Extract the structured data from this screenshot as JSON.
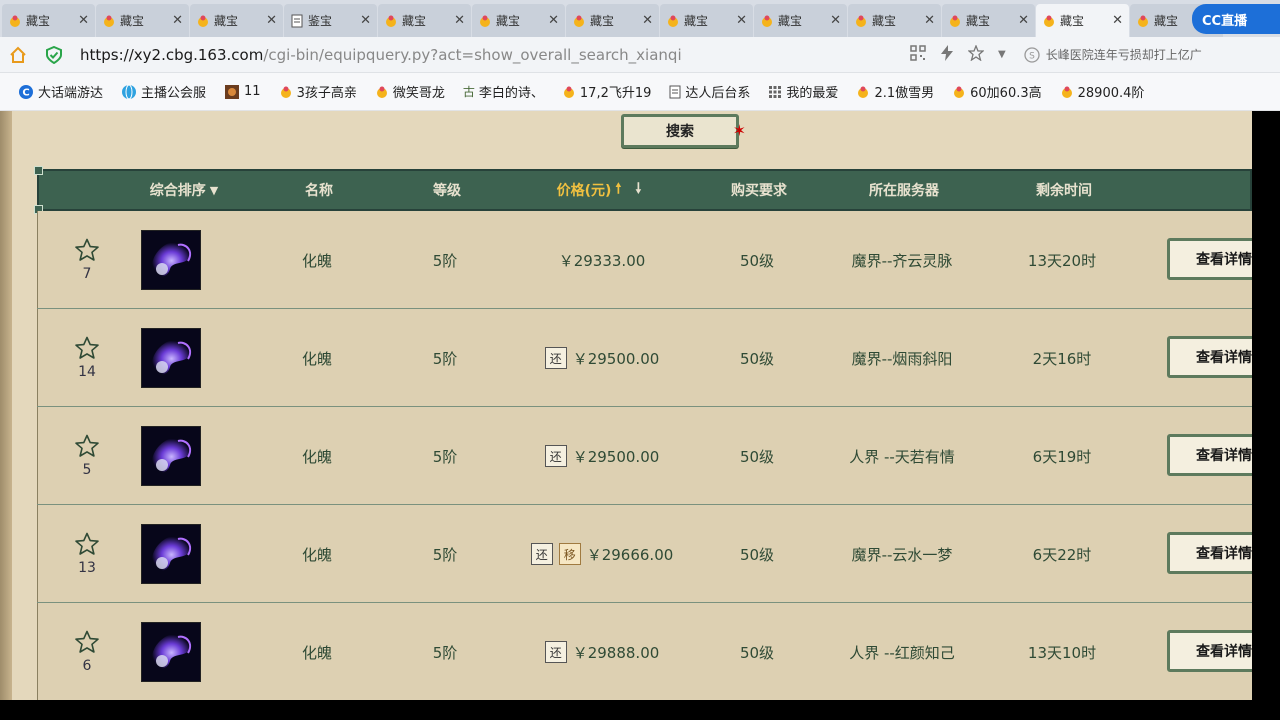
{
  "tabs": [
    {
      "label": "藏宝",
      "icon": "treasure-icon",
      "active": false
    },
    {
      "label": "藏宝",
      "icon": "treasure-icon",
      "active": false
    },
    {
      "label": "藏宝",
      "icon": "treasure-icon",
      "active": false
    },
    {
      "label": "鉴宝",
      "icon": "document-icon",
      "active": false
    },
    {
      "label": "藏宝",
      "icon": "treasure-icon",
      "active": false
    },
    {
      "label": "藏宝",
      "icon": "treasure-icon",
      "active": false
    },
    {
      "label": "藏宝",
      "icon": "treasure-icon",
      "active": false
    },
    {
      "label": "藏宝",
      "icon": "treasure-icon",
      "active": false
    },
    {
      "label": "藏宝",
      "icon": "treasure-icon",
      "active": false
    },
    {
      "label": "藏宝",
      "icon": "treasure-icon",
      "active": false
    },
    {
      "label": "藏宝",
      "icon": "treasure-icon",
      "active": false
    },
    {
      "label": "藏宝",
      "icon": "treasure-icon",
      "active": true
    },
    {
      "label": "藏宝",
      "icon": "treasure-icon",
      "active": false
    }
  ],
  "cc_badge": "CC直播",
  "address": {
    "host": "https://xy2.cbg.163.com",
    "path": "/cgi-bin/equipquery.py?act=show_overall_search_xianqi",
    "search_text": "长峰医院连年亏损却打上亿广"
  },
  "bookmarks": [
    {
      "label": "大话端游达",
      "icon": "c-logo-icon"
    },
    {
      "label": "主播公会服",
      "icon": "globe-icon"
    },
    {
      "label": "11",
      "icon": "game-icon"
    },
    {
      "label": "3孩子高亲",
      "icon": "treasure-icon"
    },
    {
      "label": "微笑哥龙",
      "icon": "treasure-icon"
    },
    {
      "label": "李白的诗、",
      "icon": "gu-icon"
    },
    {
      "label": "17,2飞升19",
      "icon": "treasure-icon"
    },
    {
      "label": "达人后台系",
      "icon": "document-icon"
    },
    {
      "label": "我的最爱",
      "icon": "grid-icon"
    },
    {
      "label": "2.1傲雪男",
      "icon": "treasure-icon"
    },
    {
      "label": "60加60.3高",
      "icon": "treasure-icon"
    },
    {
      "label": "28900.4阶",
      "icon": "treasure-icon"
    }
  ],
  "search_button": "搜索",
  "table": {
    "headers": {
      "sort": "综合排序",
      "name": "名称",
      "level": "等级",
      "price": "价格(元)",
      "requirement": "购买要求",
      "server": "所在服务器",
      "time_left": "剩余时间"
    },
    "accent_color": "#f0c040",
    "header_bg": "#3d6250",
    "rows": [
      {
        "fav": "7",
        "name": "化魄",
        "level": "5阶",
        "price": "￥29333.00",
        "tags": [],
        "requirement": "50级",
        "server": "魔界--齐云灵脉",
        "time_left": "13天20时",
        "detail": "查看详情"
      },
      {
        "fav": "14",
        "name": "化魄",
        "level": "5阶",
        "price": "￥29500.00",
        "tags": [
          "还"
        ],
        "requirement": "50级",
        "server": "魔界--烟雨斜阳",
        "time_left": "2天16时",
        "detail": "查看详情"
      },
      {
        "fav": "5",
        "name": "化魄",
        "level": "5阶",
        "price": "￥29500.00",
        "tags": [
          "还"
        ],
        "requirement": "50级",
        "server": "人界 --天若有情",
        "time_left": "6天19时",
        "detail": "查看详情"
      },
      {
        "fav": "13",
        "name": "化魄",
        "level": "5阶",
        "price": "￥29666.00",
        "tags": [
          "还",
          "移"
        ],
        "requirement": "50级",
        "server": "魔界--云水一梦",
        "time_left": "6天22时",
        "detail": "查看详情"
      },
      {
        "fav": "6",
        "name": "化魄",
        "level": "5阶",
        "price": "￥29888.00",
        "tags": [
          "还"
        ],
        "requirement": "50级",
        "server": "人界 --红颜知己",
        "time_left": "13天10时",
        "detail": "查看详情"
      }
    ]
  }
}
